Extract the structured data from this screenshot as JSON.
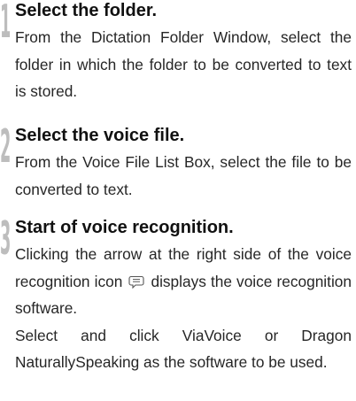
{
  "steps": [
    {
      "number": "1",
      "title": "Select the folder.",
      "body": "From the Dictation Folder Window, select the folder in which the folder to be converted to text is stored."
    },
    {
      "number": "2",
      "title": "Select the voice file.",
      "body": "From the Voice File List Box, select the file to be converted to text."
    },
    {
      "number": "3",
      "title": "Start of voice recognition.",
      "body_part1": "Clicking the arrow at the right side of the voice recognition icon",
      "icon": "voice-recognition-icon",
      "body_part2": "displays the voice recognition software.",
      "body_para2": "Select and click ViaVoice or Dragon NaturallySpeaking as the software to be used."
    }
  ]
}
